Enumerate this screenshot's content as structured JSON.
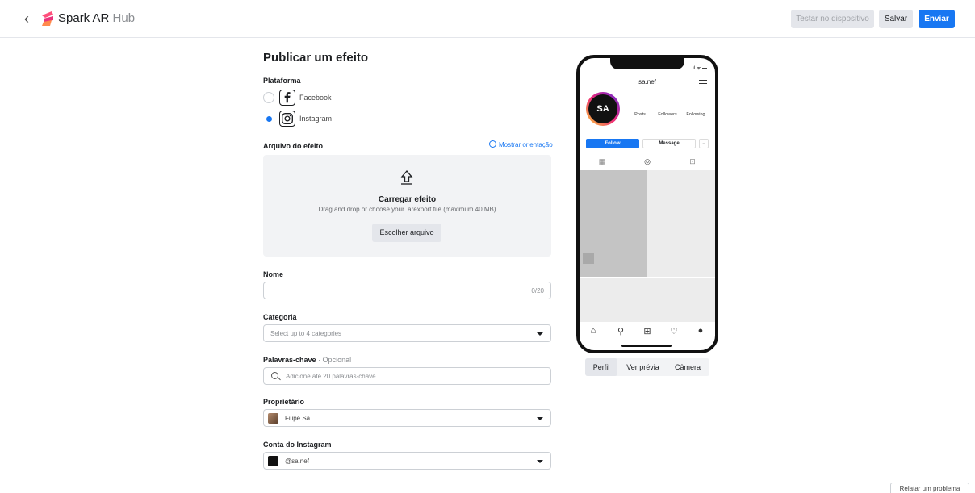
{
  "header": {
    "brand_main": "Spark AR",
    "brand_sub": "Hub",
    "test_label": "Testar no dispositivo",
    "save_label": "Salvar",
    "send_label": "Enviar"
  },
  "form": {
    "title": "Publicar um efeito",
    "platform_label": "Plataforma",
    "platforms": [
      {
        "label": "Facebook",
        "selected": false,
        "icon": "facebook-icon"
      },
      {
        "label": "Instagram",
        "selected": true,
        "icon": "instagram-icon"
      }
    ],
    "file_label": "Arquivo do efeito",
    "show_guide": "Mostrar orientação",
    "upload_title": "Carregar efeito",
    "upload_hint": "Drag and drop or choose your .arexport file (maximum 40 MB)",
    "choose_file": "Escolher arquivo",
    "name_label": "Nome",
    "name_value": "",
    "name_count": "0/20",
    "category_label": "Categoria",
    "category_placeholder": "Select up to 4 categories",
    "keywords_label": "Palavras-chave",
    "keywords_optional": " · Opcional",
    "keywords_placeholder": "Adicione até 20 palavras-chave",
    "owner_label": "Proprietário",
    "owner_value": "Filipe Sá",
    "ig_account_label": "Conta do Instagram",
    "ig_account_value": "@sa.nef"
  },
  "phone": {
    "status": "..ıl ᯤ ▬",
    "username": "sa.nef",
    "avatar_text": "SA",
    "stats": [
      {
        "value": "—",
        "label": "Posts"
      },
      {
        "value": "—",
        "label": "Followers"
      },
      {
        "value": "—",
        "label": "Following"
      }
    ],
    "follow": "Follow",
    "message": "Message",
    "more": "⌄",
    "tabs": [
      "▦",
      "◎",
      "⊡"
    ],
    "nav": [
      "⌂",
      "⚲",
      "⊞",
      "♡",
      "●"
    ]
  },
  "preview_tabs": [
    "Perfil",
    "Ver prévia",
    "Câmera"
  ],
  "report_label": "Relatar um problema",
  "colors": {
    "accent": "#1877f2",
    "surface": "#f2f3f5"
  }
}
